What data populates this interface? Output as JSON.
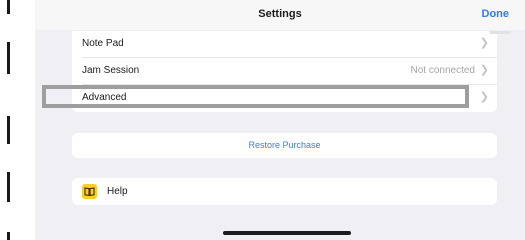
{
  "nav": {
    "title": "Settings",
    "done_label": "Done"
  },
  "settings_rows": [
    {
      "label": "Note Pad",
      "value": "",
      "chevron": "chevron-right-icon"
    },
    {
      "label": "Jam Session",
      "value": "Not connected",
      "chevron": "chevron-right-icon"
    },
    {
      "label": "Advanced",
      "value": "",
      "chevron": "chevron-right-icon"
    }
  ],
  "restore": {
    "label": "Restore Purchase"
  },
  "help": {
    "label": "Help",
    "icon": "book-icon",
    "icon_color": "#fbcf1e"
  },
  "colors": {
    "accent": "#2f7cf6",
    "background": "#efeff4",
    "highlight_border": "#9e9e9e"
  }
}
